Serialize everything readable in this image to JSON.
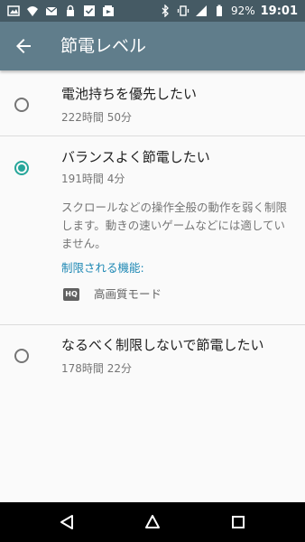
{
  "status_bar": {
    "battery": "92%",
    "time": "19:01",
    "icons": [
      "image-icon",
      "wifi-icon",
      "mail-icon",
      "lock-icon",
      "checkbox-icon",
      "photo-icon",
      "bluetooth-icon",
      "vibrate-icon",
      "signal-icon",
      "battery-icon"
    ]
  },
  "toolbar": {
    "title": "節電レベル",
    "back_icon": "arrow-back-icon"
  },
  "options": [
    {
      "title": "電池持ちを優先したい",
      "subtitle": "222時間 50分",
      "selected": false
    },
    {
      "title": "バランスよく節電したい",
      "subtitle": "191時間 4分",
      "selected": true,
      "description": "スクロールなどの操作全般の動作を弱く制限します。動きの速いゲームなどには適していません。",
      "limited_label": "制限される機能:",
      "feature_icon_text": "HQ",
      "feature_label": "高画質モード"
    },
    {
      "title": "なるべく制限しないで節電したい",
      "subtitle": "178時間 22分",
      "selected": false
    }
  ],
  "nav_bar": {
    "icons": [
      "back-triangle-icon",
      "home-circle-icon",
      "recents-square-icon"
    ]
  },
  "colors": {
    "status_bar": "#455a64",
    "toolbar": "#607d8b",
    "accent": "#26a69a",
    "link": "#1e88b4"
  }
}
